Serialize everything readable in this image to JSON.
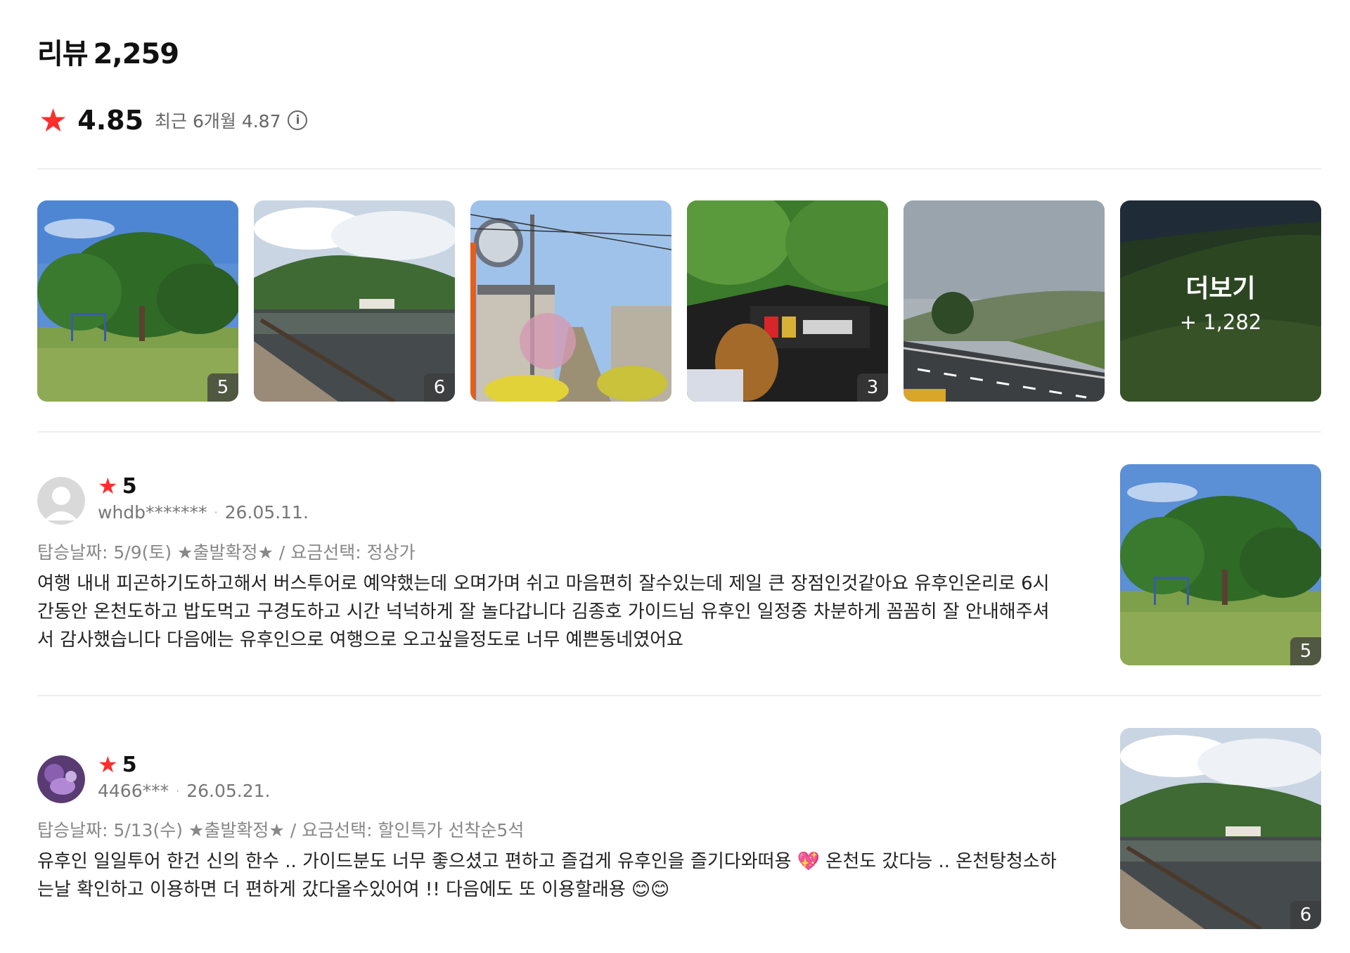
{
  "header": {
    "title": "리뷰",
    "count": "2,259"
  },
  "rating": {
    "star_icon": "star-icon",
    "score": "4.85",
    "recent_label": "최근 6개월 4.87",
    "info_icon": "info-icon",
    "info_glyph": "i"
  },
  "gallery": {
    "thumbs": [
      {
        "label": "5"
      },
      {
        "label": "6"
      },
      {
        "label": ""
      },
      {
        "label": "3"
      },
      {
        "label": ""
      }
    ],
    "more": {
      "label": "더보기",
      "count": "+ 1,282"
    }
  },
  "reviews": [
    {
      "rating": "5",
      "user": "whdb*******",
      "date": "26.05.11.",
      "options": "탑승날짜: 5/9(토) ★출발확정★ / 요금선택: 정상가",
      "text": "여행 내내 피곤하기도하고해서 버스투어로 예약했는데 오며가며 쉬고 마음편히 잘수있는데 제일 큰 장점인것같아요 유후인온리로 6시간동안 온천도하고 밥도먹고 구경도하고 시간 넉넉하게 잘 놀다갑니다 김종호 가이드님 유후인 일정중 차분하게 꼼꼼히 잘 안내해주셔서 감사했습니다 다음에는 유후인으로 여행으로 오고싶을정도로 너무 예쁜동네였어요",
      "photo_count": "5"
    },
    {
      "rating": "5",
      "user": "4466***",
      "date": "26.05.21.",
      "options": "탑승날짜: 5/13(수) ★출발확정★ / 요금선택: 할인특가 선착순5석",
      "text": "유후인 일일투어 한건 신의 한수 .. 가이드분도 너무 좋으셨고 편하고 즐겁게 유후인을 즐기다와떠용 💖 온천도 갔다능 .. 온천탕청소하는날 확인하고 이용하면 더 편하게 갔다올수있어여 !! 다음에도 또 이용할래용 😊😊",
      "photo_count": "6"
    }
  ],
  "icons": {
    "star": "★",
    "dot": "·"
  },
  "colors": {
    "accent_star": "#ff2d2d",
    "text_primary": "#111111",
    "text_secondary": "#777777",
    "divider": "#eeeeee"
  }
}
